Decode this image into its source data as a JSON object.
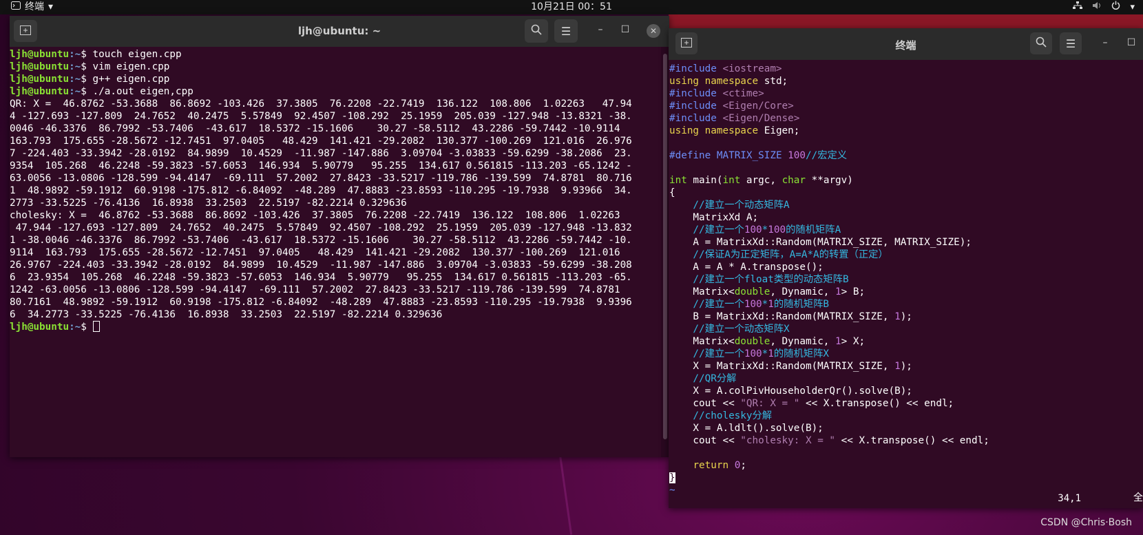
{
  "topbar": {
    "app_menu": "终端",
    "clock": "10月21日  00：51",
    "tray_icons": [
      "network-icon",
      "volume-icon",
      "power-icon",
      "chevron-down-icon"
    ]
  },
  "terminal1": {
    "title": "ljh@ubuntu: ~",
    "prompt_user": "ljh@ubuntu",
    "prompt_path": ":~$ ",
    "commands": [
      "touch eigen.cpp",
      "vim eigen.cpp",
      "g++ eigen.cpp",
      "./a.out eigen,cpp"
    ],
    "output": [
      "QR: X =  46.8762 -53.3688  86.8692 -103.426  37.3805  76.2208 -22.7419  136.122  108.806  1.02263   47.94",
      "4 -127.693 -127.809  24.7652  40.2475  5.57849  92.4507 -108.292  25.1959  205.039 -127.948 -13.8321 -38.",
      "0046 -46.3376  86.7992 -53.7406  -43.617  18.5372 -15.1606    30.27 -58.5112  43.2286 -59.7442 -10.9114",
      "163.793  175.655 -28.5672 -12.7451  97.0405   48.429  141.421 -29.2082  130.377 -100.269  121.016  26.976",
      "7 -224.403 -33.3942 -28.0192  84.9899  10.4529  -11.987 -147.886  3.09704 -3.03833 -59.6299 -38.2086  23.",
      "9354  105.268  46.2248 -59.3823 -57.6053  146.934  5.90779   95.255  134.617 0.561815 -113.203 -65.1242 -",
      "63.0056 -13.0806 -128.599 -94.4147  -69.111  57.2002  27.8423 -33.5217 -119.786 -139.599  74.8781  80.716",
      "1  48.9892 -59.1912  60.9198 -175.812 -6.84092  -48.289  47.8883 -23.8593 -110.295 -19.7938  9.93966  34.",
      "2773 -33.5225 -76.4136  16.8938  33.2503  22.5197 -82.2214 0.329636",
      "cholesky: X =  46.8762 -53.3688  86.8692 -103.426  37.3805  76.2208 -22.7419  136.122  108.806  1.02263",
      " 47.944 -127.693 -127.809  24.7652  40.2475  5.57849  92.4507 -108.292  25.1959  205.039 -127.948 -13.832",
      "1 -38.0046 -46.3376  86.7992 -53.7406  -43.617  18.5372 -15.1606    30.27 -58.5112  43.2286 -59.7442 -10.",
      "9114  163.793  175.655 -28.5672 -12.7451  97.0405   48.429  141.421 -29.2082  130.377 -100.269  121.016",
      "26.9767 -224.403 -33.3942 -28.0192  84.9899  10.4529  -11.987 -147.886  3.09704 -3.03833 -59.6299 -38.208",
      "6  23.9354  105.268  46.2248 -59.3823 -57.6053  146.934  5.90779   95.255  134.617 0.561815 -113.203 -65.",
      "1242 -63.0056 -13.0806 -128.599 -94.4147  -69.111  57.2002  27.8423 -33.5217 -119.786 -139.599  74.8781",
      "80.7161  48.9892 -59.1912  60.9198 -175.812 -6.84092  -48.289  47.8883 -23.8593 -110.295 -19.7938  9.9396",
      "6  34.2773 -33.5225 -76.4136  16.8938  33.2503  22.5197 -82.2214 0.329636"
    ]
  },
  "terminal2": {
    "title": "终端",
    "code_lines": [
      [
        {
          "t": "#include ",
          "c": "pre"
        },
        {
          "t": "<iostream>",
          "c": "str"
        }
      ],
      [
        {
          "t": "using",
          "c": "kw"
        },
        {
          "t": " "
        },
        {
          "t": "namespace",
          "c": "kw"
        },
        {
          "t": " std;"
        }
      ],
      [
        {
          "t": "#include ",
          "c": "pre"
        },
        {
          "t": "<ctime>",
          "c": "str"
        }
      ],
      [
        {
          "t": "#include ",
          "c": "pre"
        },
        {
          "t": "<Eigen/Core>",
          "c": "str"
        }
      ],
      [
        {
          "t": "#include ",
          "c": "pre"
        },
        {
          "t": "<Eigen/Dense>",
          "c": "str"
        }
      ],
      [
        {
          "t": "using",
          "c": "kw"
        },
        {
          "t": " "
        },
        {
          "t": "namespace",
          "c": "kw"
        },
        {
          "t": " Eigen;"
        }
      ],
      [],
      [
        {
          "t": "#define ",
          "c": "pre"
        },
        {
          "t": "MATRIX_SIZE ",
          "c": "pre"
        },
        {
          "t": "100",
          "c": "num"
        },
        {
          "t": "//宏定义",
          "c": "cm"
        }
      ],
      [],
      [
        {
          "t": "int",
          "c": "ty"
        },
        {
          "t": " main("
        },
        {
          "t": "int",
          "c": "ty"
        },
        {
          "t": " argc, "
        },
        {
          "t": "char",
          "c": "ty"
        },
        {
          "t": " **argv)"
        }
      ],
      [
        {
          "t": "{"
        }
      ],
      [
        {
          "t": "    //建立一个动态矩阵A",
          "c": "cm"
        }
      ],
      [
        {
          "t": "    MatrixXd A;"
        }
      ],
      [
        {
          "t": "    //建立一个",
          "c": "cm"
        },
        {
          "t": "100",
          "c": "num"
        },
        {
          "t": "*",
          "c": "cm"
        },
        {
          "t": "100",
          "c": "num"
        },
        {
          "t": "的随机矩阵A",
          "c": "cm"
        }
      ],
      [
        {
          "t": "    A = MatrixXd::Random(MATRIX_SIZE, MATRIX_SIZE);"
        }
      ],
      [
        {
          "t": "    //保证A为正定矩阵，A=A*A的转置（正定）",
          "c": "cm"
        }
      ],
      [
        {
          "t": "    A = A * A.transpose();"
        }
      ],
      [
        {
          "t": "    //建立一个float类型的动态矩阵B",
          "c": "cm"
        }
      ],
      [
        {
          "t": "    Matrix<"
        },
        {
          "t": "double",
          "c": "ty"
        },
        {
          "t": ", Dynamic, "
        },
        {
          "t": "1",
          "c": "num"
        },
        {
          "t": "> B;"
        }
      ],
      [
        {
          "t": "    //建立一个",
          "c": "cm"
        },
        {
          "t": "100",
          "c": "num"
        },
        {
          "t": "*",
          "c": "cm"
        },
        {
          "t": "1",
          "c": "num"
        },
        {
          "t": "的随机矩阵B",
          "c": "cm"
        }
      ],
      [
        {
          "t": "    B = MatrixXd::Random(MATRIX_SIZE, "
        },
        {
          "t": "1",
          "c": "num"
        },
        {
          "t": ");"
        }
      ],
      [
        {
          "t": "    //建立一个动态矩阵X",
          "c": "cm"
        }
      ],
      [
        {
          "t": "    Matrix<"
        },
        {
          "t": "double",
          "c": "ty"
        },
        {
          "t": ", Dynamic, "
        },
        {
          "t": "1",
          "c": "num"
        },
        {
          "t": "> X;"
        }
      ],
      [
        {
          "t": "    //建立一个",
          "c": "cm"
        },
        {
          "t": "100",
          "c": "num"
        },
        {
          "t": "*",
          "c": "cm"
        },
        {
          "t": "1",
          "c": "num"
        },
        {
          "t": "的随机矩阵X",
          "c": "cm"
        }
      ],
      [
        {
          "t": "    X = MatrixXd::Random(MATRIX_SIZE, "
        },
        {
          "t": "1",
          "c": "num"
        },
        {
          "t": ");"
        }
      ],
      [
        {
          "t": "    //QR分解",
          "c": "cm"
        }
      ],
      [
        {
          "t": "    X = A.colPivHouseholderQr().solve(B);"
        }
      ],
      [
        {
          "t": "    cout << "
        },
        {
          "t": "\"QR: X = \"",
          "c": "str"
        },
        {
          "t": " << X.transpose() << endl;"
        }
      ],
      [
        {
          "t": "    //cholesky分解",
          "c": "cm"
        }
      ],
      [
        {
          "t": "    X = A.ldlt().solve(B);"
        }
      ],
      [
        {
          "t": "    cout << "
        },
        {
          "t": "\"cholesky: X = \"",
          "c": "str"
        },
        {
          "t": " << X.transpose() << endl;"
        }
      ],
      [],
      [
        {
          "t": "    "
        },
        {
          "t": "return",
          "c": "kw"
        },
        {
          "t": " "
        },
        {
          "t": "0",
          "c": "num"
        },
        {
          "t": ";"
        }
      ],
      [
        {
          "t": "}",
          "c": "cur"
        }
      ],
      [
        {
          "t": "~",
          "c": "tilde"
        }
      ]
    ],
    "vim_position": "34,1",
    "vim_scroll": "全"
  },
  "watermark": "CSDN @Chris·Bosh"
}
